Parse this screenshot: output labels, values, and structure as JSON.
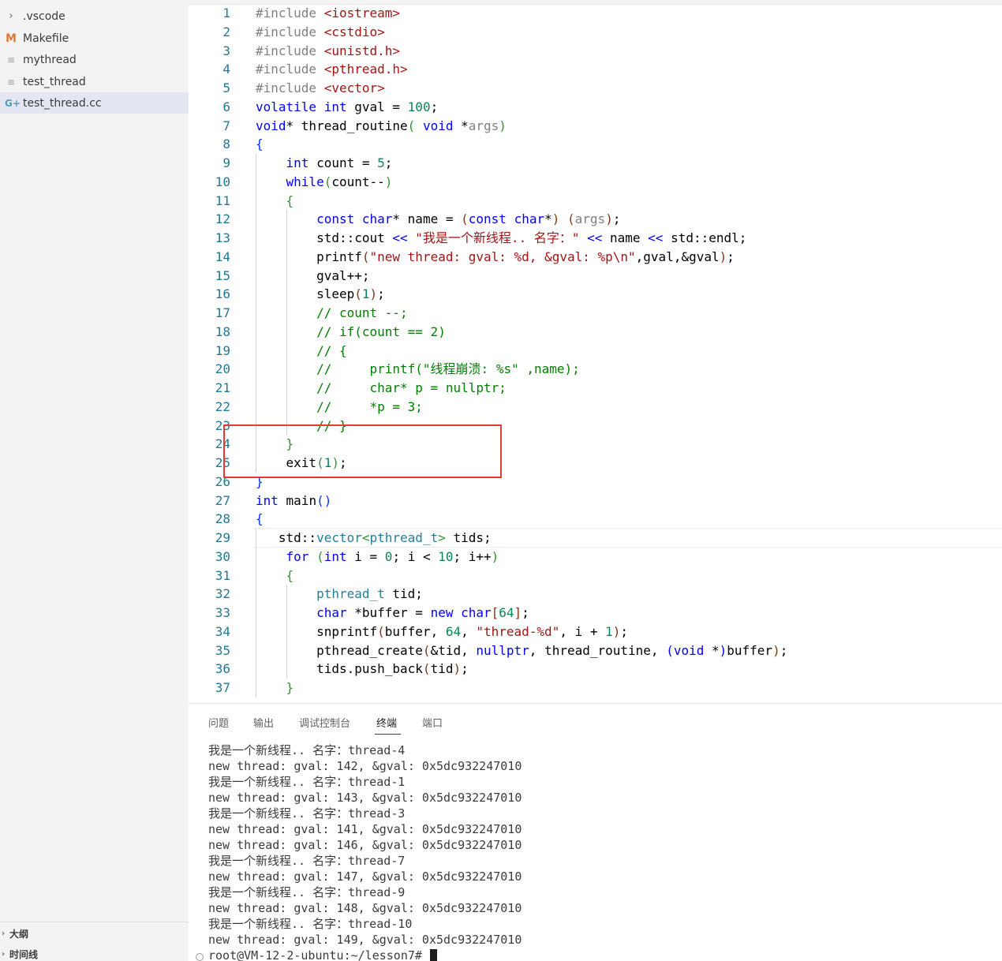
{
  "explorer": {
    "items": [
      {
        "icon": "chevron-right-icon",
        "glyph": "›",
        "name": ".vscode"
      },
      {
        "icon": "makefile-icon",
        "glyph": "M",
        "name": "Makefile"
      },
      {
        "icon": "text-file-icon",
        "glyph": "≡",
        "name": "mythread"
      },
      {
        "icon": "text-file-icon",
        "glyph": "≡",
        "name": "test_thread"
      },
      {
        "icon": "cpp-file-icon",
        "glyph": "G+",
        "name": "test_thread.cc"
      }
    ],
    "active_index": 4
  },
  "sections": {
    "outline": "大纲",
    "timeline": "时间线"
  },
  "editor": {
    "line_numbers": [
      "1",
      "2",
      "3",
      "4",
      "5",
      "6",
      "7",
      "8",
      "9",
      "10",
      "11",
      "12",
      "13",
      "14",
      "15",
      "16",
      "17",
      "18",
      "19",
      "20",
      "21",
      "22",
      "23",
      "24",
      "25",
      "26",
      "27",
      "28",
      "29",
      "30",
      "31",
      "32",
      "33",
      "34",
      "35",
      "36",
      "37"
    ]
  },
  "panel": {
    "tabs": [
      "问题",
      "输出",
      "调试控制台",
      "终端",
      "端口"
    ],
    "active_tab": "终端"
  },
  "terminal": {
    "lines": [
      "我是一个新线程.. 名字：thread-4",
      "new thread: gval: 142, &gval: 0x5dc932247010",
      "我是一个新线程.. 名字：thread-1",
      "new thread: gval: 143, &gval: 0x5dc932247010",
      "我是一个新线程.. 名字：thread-3",
      "new thread: gval: 141, &gval: 0x5dc932247010",
      "new thread: gval: 146, &gval: 0x5dc932247010",
      "我是一个新线程.. 名字：thread-7",
      "new thread: gval: 147, &gval: 0x5dc932247010",
      "我是一个新线程.. 名字：thread-9",
      "new thread: gval: 148, &gval: 0x5dc932247010",
      "我是一个新线程.. 名字：thread-10",
      "new thread: gval: 149, &gval: 0x5dc932247010"
    ],
    "prompt": "root@VM-12-2-ubuntu:~/lesson7# "
  },
  "colors": {
    "highlight_box": "#e53935",
    "keyword": "#0000ff",
    "string": "#a31515",
    "number": "#098658",
    "line_number": "#237893"
  }
}
